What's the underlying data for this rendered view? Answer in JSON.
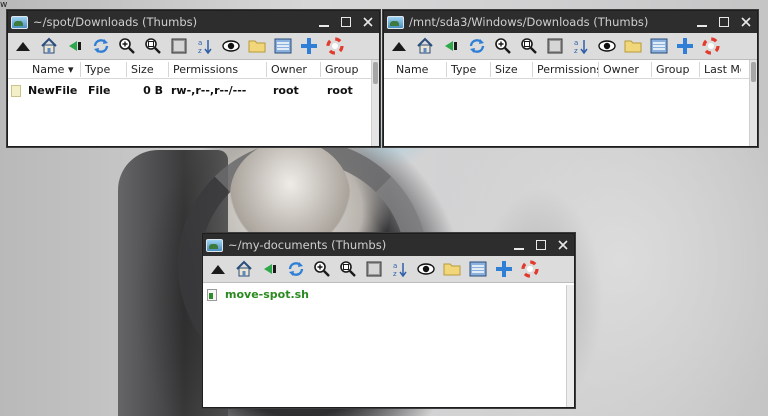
{
  "desktop": {
    "corner_glyph": "w"
  },
  "windows": [
    {
      "title": "~/spot/Downloads (Thumbs)",
      "columns": [
        "Name",
        "Type",
        "Size",
        "Permissions",
        "Owner",
        "Group"
      ],
      "rows": [
        {
          "name": "NewFile",
          "type": "File",
          "size": "0 B",
          "permissions": "rw-,r--,r--/---",
          "owner": "root",
          "group": "root"
        }
      ]
    },
    {
      "title": "/mnt/sda3/Windows/Downloads (Thumbs)",
      "columns": [
        "Name",
        "Type",
        "Size",
        "Permissions",
        "Owner",
        "Group",
        "Last Mo"
      ],
      "rows": []
    },
    {
      "title": "~/my-documents (Thumbs)",
      "rows": [
        {
          "name": "move-spot.sh"
        }
      ]
    }
  ],
  "titlebar_buttons": {
    "minimize": "minimize-icon",
    "maximize": "maximize-icon",
    "close": "close-icon"
  },
  "toolbar_icons": [
    "up-arrow-icon",
    "home-icon",
    "back-icon",
    "refresh-icon",
    "zoom-in-icon",
    "zoom-out-icon",
    "view-icon",
    "sort-icon",
    "eye-icon",
    "folder-icon",
    "list-view-icon",
    "add-icon",
    "help-icon"
  ],
  "colors": {
    "titlebar": "#2d2d2d",
    "toolbar": "#dcdcdc",
    "script_file_text": "#2a8a1f",
    "add_blue": "#2f7fd6",
    "help_red": "#e23b2e"
  }
}
